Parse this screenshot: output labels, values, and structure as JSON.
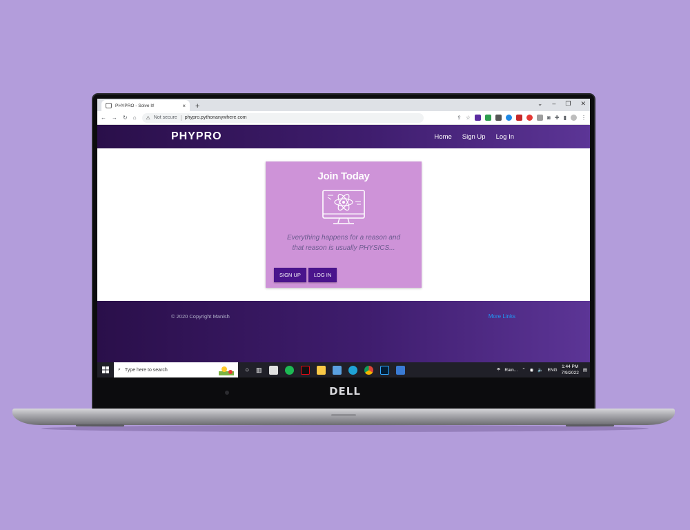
{
  "browser": {
    "tab_title": "PHYPRO - Solve It!",
    "new_tab": "+",
    "close_tab": "×",
    "security_label": "Not secure",
    "url": "phypro.pythonanywhere.com"
  },
  "site": {
    "logo": "PHYPRO",
    "nav": [
      "Home",
      "Sign Up",
      "Log In"
    ],
    "card": {
      "title": "Join Today",
      "quote": "Everything happens for a reason and that reason is usually PHYSICS...",
      "signup_button": "SIGN UP",
      "login_button": "LOG IN"
    },
    "footer": {
      "copyright": "© 2020 Copyright Manish",
      "more_links": "More Links"
    }
  },
  "taskbar": {
    "search_placeholder": "Type here to search",
    "weather": "Rain...",
    "language": "ENG",
    "time": "1:44 PM",
    "date": "7/9/2022"
  },
  "laptop": {
    "brand": "DELL"
  },
  "colors": {
    "background": "#b39ddb",
    "nav_gradient_start": "#2a0f4a",
    "nav_gradient_end": "#5c3596",
    "card": "#ce93d8",
    "button": "#4a148c",
    "link": "#2196f3"
  }
}
